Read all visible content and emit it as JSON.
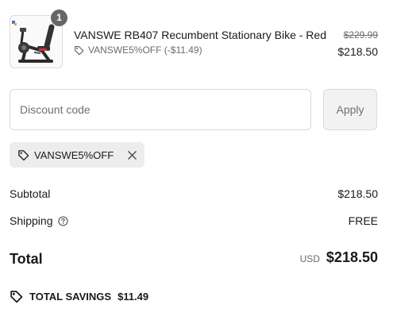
{
  "product": {
    "quantity": "1",
    "title": "VANSWE RB407 Recumbent Stationary Bike - Red",
    "discount_text": "VANSWE5%OFF (-$11.49)",
    "compare_price": "$229.99",
    "price": "$218.50",
    "image_icon": "recumbent-bike-image"
  },
  "discount": {
    "placeholder": "Discount code",
    "apply_label": "Apply",
    "applied_code": "VANSWE5%OFF"
  },
  "summary": {
    "subtotal_label": "Subtotal",
    "subtotal_value": "$218.50",
    "shipping_label": "Shipping",
    "shipping_value": "FREE",
    "total_label": "Total",
    "currency": "USD",
    "total_value": "$218.50",
    "savings_label": "TOTAL SAVINGS",
    "savings_value": "$11.49"
  },
  "icons": {
    "tag": "tag-icon",
    "close": "close-icon",
    "help": "help-circle-icon"
  },
  "colors": {
    "badge": "#666666",
    "chip_bg": "#ededed",
    "muted_text": "#6b6b6b",
    "bike_accent": "#d0303a"
  }
}
